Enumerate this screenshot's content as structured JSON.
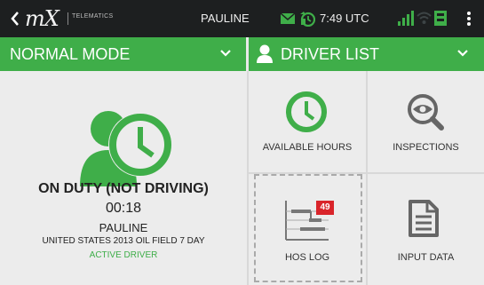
{
  "statusbar": {
    "logo_text": "mX",
    "brand_sub": "TELEMATICS",
    "user": "PAULINE",
    "time": "7:49 UTC",
    "icons": [
      "back-arrow-icon",
      "mail-icon",
      "alarm-icon",
      "signal-icon",
      "wifi-icon",
      "device-icon",
      "overflow-menu-icon"
    ]
  },
  "header": {
    "mode_label": "NORMAL MODE",
    "driver_list_label": "DRIVER LIST"
  },
  "driver": {
    "status": "ON DUTY (NOT DRIVING)",
    "duration": "00:18",
    "name": "PAULINE",
    "ruleset": "UNITED STATES 2013 OIL FIELD 7 DAY",
    "role": "ACTIVE DRIVER"
  },
  "tiles": {
    "available_hours": "AVAILABLE HOURS",
    "inspections": "INSPECTIONS",
    "hos_log": "HOS LOG",
    "hos_log_badge": "49",
    "input_data": "INPUT DATA"
  },
  "colors": {
    "accent": "#3fae49",
    "statusbar": "#1d1f20",
    "background": "#ececec",
    "badge": "#d9242a"
  }
}
